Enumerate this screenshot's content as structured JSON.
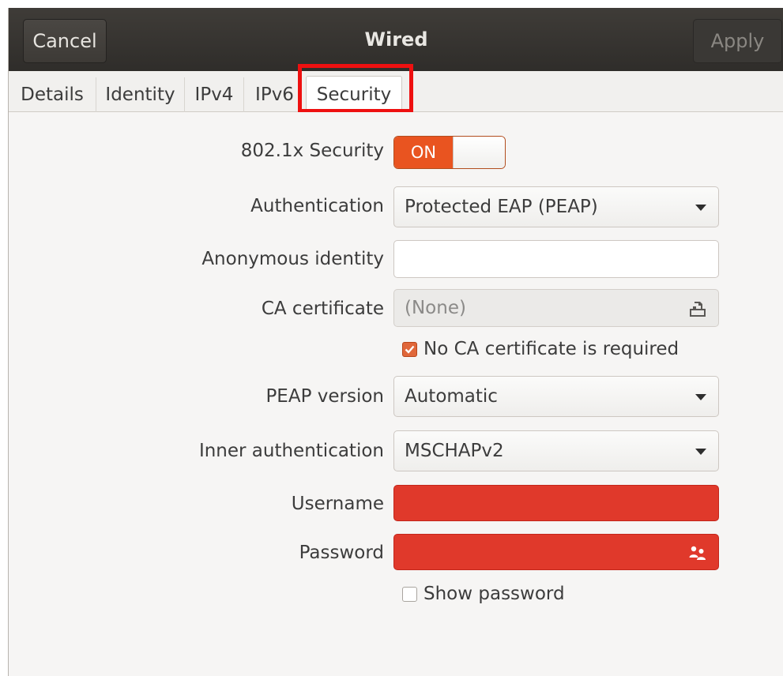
{
  "header": {
    "title": "Wired",
    "cancel_label": "Cancel",
    "apply_label": "Apply"
  },
  "tabs": [
    {
      "label": "Details"
    },
    {
      "label": "Identity"
    },
    {
      "label": "IPv4"
    },
    {
      "label": "IPv6"
    },
    {
      "label": "Security",
      "active": true
    }
  ],
  "security": {
    "toggle_label": "802.1x Security",
    "toggle_state": "ON",
    "authentication_label": "Authentication",
    "authentication_value": "Protected EAP (PEAP)",
    "anonymous_identity_label": "Anonymous identity",
    "anonymous_identity_value": "",
    "ca_certificate_label": "CA certificate",
    "ca_certificate_value": "(None)",
    "no_ca_required_label": "No CA certificate is required",
    "no_ca_required_checked": true,
    "peap_version_label": "PEAP version",
    "peap_version_value": "Automatic",
    "inner_auth_label": "Inner authentication",
    "inner_auth_value": "MSCHAPv2",
    "username_label": "Username",
    "username_value": "",
    "password_label": "Password",
    "password_value": "",
    "show_password_label": "Show password",
    "show_password_checked": false
  },
  "colors": {
    "accent": "#e95420",
    "error_field": "#e0392b",
    "highlight_box": "#ee1010",
    "headerbar": "#34322f"
  },
  "icons": {
    "ca_certificate": "file-open-icon",
    "password": "key-people-icon",
    "combo": "chevron-down-icon"
  }
}
